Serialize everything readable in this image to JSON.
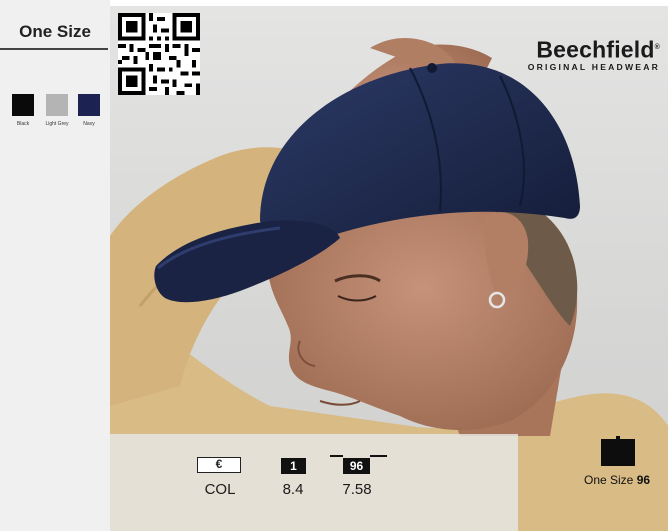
{
  "sidebar": {
    "size_title": "One Size",
    "colors": [
      {
        "label": "Black",
        "hex": "#0a0a0a"
      },
      {
        "label": "Light Grey",
        "hex": "#b4b4b4"
      },
      {
        "label": "Navy",
        "hex": "#1c2352"
      }
    ]
  },
  "brand": {
    "name": "Beechfield",
    "registered": "®",
    "tagline": "ORIGINAL HEADWEAR"
  },
  "pricing": {
    "currency_badge": "€",
    "qty_badge_1": "1",
    "qty_badge_96": "96",
    "price_labels": [
      "COL",
      "8.4",
      "7.58"
    ]
  },
  "pack": {
    "size_label": "One Size",
    "quantity": "96"
  },
  "product_colors": {
    "cap": "#1f2a4d",
    "sweater": "#d9bb86",
    "skin": "#b98569"
  }
}
